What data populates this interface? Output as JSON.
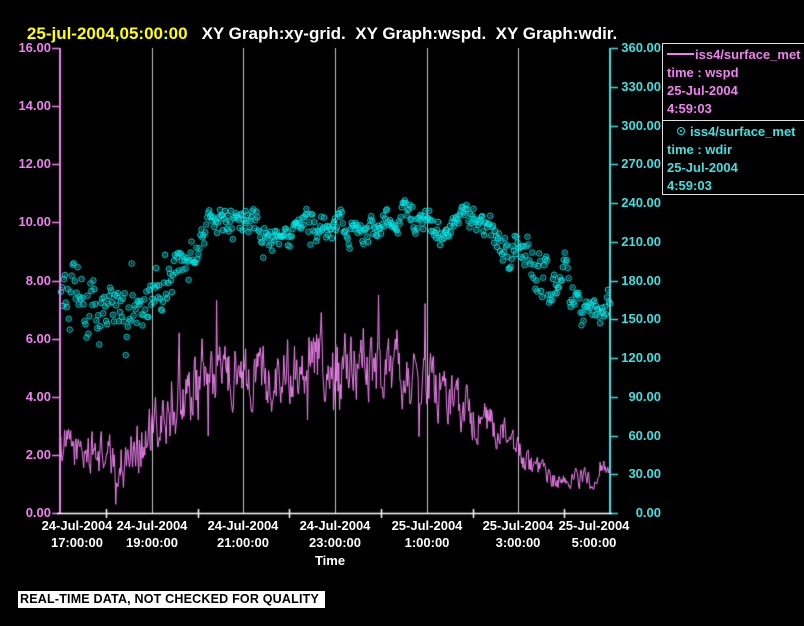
{
  "title": {
    "timestamp": "25-jul-2004,05:00:00",
    "graphs": "XY Graph:xy-grid.  XY Graph:wspd.  XY Graph:wdir."
  },
  "colors": {
    "background": "#000000",
    "title_time": "#ffff00",
    "title_text": "#ffffff",
    "wspd": "#ee82ee",
    "wdir_marker": "#00eeee",
    "wdir_text": "#40e0e0",
    "grid": "#c4c4c4",
    "x_axis": "#ffffff"
  },
  "left_axis": {
    "tick_labels": [
      "16.00",
      "14.00",
      "12.00",
      "10.00",
      "8.00",
      "6.00",
      "4.00",
      "2.00",
      "0.00"
    ]
  },
  "right_axis": {
    "tick_labels": [
      "360.00",
      "330.00",
      "300.00",
      "270.00",
      "240.00",
      "210.00",
      "180.00",
      "150.00",
      "120.00",
      "90.00",
      "60.00",
      "30.00",
      "0.00"
    ]
  },
  "x_axis": {
    "title": "Time",
    "ticks": [
      {
        "date": "24-Jul-2004",
        "time": "17:00:00"
      },
      {
        "date": "24-Jul-2004",
        "time": "19:00:00"
      },
      {
        "date": "24-Jul-2004",
        "time": "21:00:00"
      },
      {
        "date": "24-Jul-2004",
        "time": "23:00:00"
      },
      {
        "date": "25-Jul-2004",
        "time": "1:00:00"
      },
      {
        "date": "25-Jul-2004",
        "time": "3:00:00"
      },
      {
        "date": "25-Jul-2004",
        "time": "5:00:00"
      }
    ]
  },
  "legend": {
    "entries": [
      {
        "symbol": "line",
        "source": "iss4/surface_met",
        "field": "time : wspd",
        "date": "25-Jul-2004",
        "time": "4:59:03",
        "color": "#ee82ee"
      },
      {
        "symbol": "circle",
        "source": "iss4/surface_met",
        "field": "time : wdir",
        "date": "25-Jul-2004",
        "time": "4:59:03",
        "color": "#40e0e0"
      }
    ]
  },
  "banner": "REAL-TIME DATA, NOT CHECKED FOR QUALITY",
  "chart_data": {
    "type": "line+scatter",
    "title": "XY Graph: wspd (line, left axis) and wdir (scatter, right axis) vs Time",
    "xlabel": "Time",
    "x_range_hours": [
      0,
      12
    ],
    "x_start_label": "24-Jul-2004 17:00:00",
    "x_end_label": "25-Jul-2004 05:00:00",
    "left_ylim": [
      0,
      16
    ],
    "right_ylim": [
      0,
      360
    ],
    "grid": "vertical gridlines at 2-hour major ticks",
    "grid_hours": [
      2,
      4,
      6,
      8,
      10
    ],
    "minor_tick_hours": [
      1,
      3,
      5,
      7,
      9,
      11
    ],
    "legend_position": "top-right",
    "series": [
      {
        "name": "wspd",
        "type": "line",
        "axis": "left",
        "color": "#ee82ee",
        "points_per_hour": 60,
        "seed": 1234,
        "mean_keyframes": [
          [
            0,
            2.4
          ],
          [
            0.5,
            2.1
          ],
          [
            1,
            2.0
          ],
          [
            1.3,
            1.5
          ],
          [
            1.6,
            2.3
          ],
          [
            2,
            2.6
          ],
          [
            2.5,
            3.6
          ],
          [
            3,
            4.3
          ],
          [
            3.5,
            4.7
          ],
          [
            4,
            4.9
          ],
          [
            4.5,
            4.6
          ],
          [
            5,
            5.0
          ],
          [
            5.5,
            5.3
          ],
          [
            6,
            5.1
          ],
          [
            6.5,
            5.0
          ],
          [
            7,
            4.9
          ],
          [
            7.5,
            4.7
          ],
          [
            8,
            4.5
          ],
          [
            8.5,
            4.0
          ],
          [
            9,
            3.4
          ],
          [
            9.5,
            2.9
          ],
          [
            10,
            2.1
          ],
          [
            10.4,
            1.4
          ],
          [
            10.8,
            1.1
          ],
          [
            11.2,
            1.2
          ],
          [
            11.6,
            1.2
          ],
          [
            12,
            1.5
          ]
        ],
        "noise_sd_keyframes": [
          [
            0,
            0.6
          ],
          [
            1,
            0.7
          ],
          [
            2,
            0.9
          ],
          [
            3,
            1.0
          ],
          [
            4,
            0.9
          ],
          [
            5,
            1.0
          ],
          [
            6,
            1.0
          ],
          [
            7,
            0.95
          ],
          [
            8,
            0.9
          ],
          [
            9,
            0.7
          ],
          [
            10,
            0.45
          ],
          [
            11,
            0.3
          ],
          [
            12,
            0.35
          ]
        ],
        "anomalies": [
          [
            1.22,
            0.3
          ],
          [
            2.6,
            6.2
          ],
          [
            3.1,
            6.0
          ],
          [
            5.7,
            6.9
          ],
          [
            7.35,
            6.3
          ]
        ]
      },
      {
        "name": "wdir",
        "type": "scatter",
        "axis": "right",
        "color": "#00eeee",
        "n_points": 560,
        "seed": 9271,
        "mean_keyframes": [
          [
            0,
            160
          ],
          [
            0.5,
            168
          ],
          [
            1,
            150
          ],
          [
            1.5,
            148
          ],
          [
            2,
            168
          ],
          [
            2.5,
            188
          ],
          [
            3,
            205
          ],
          [
            3.3,
            228
          ],
          [
            3.7,
            225
          ],
          [
            4,
            224
          ],
          [
            4.5,
            220
          ],
          [
            5,
            213
          ],
          [
            5.3,
            222
          ],
          [
            5.7,
            218
          ],
          [
            6,
            226
          ],
          [
            6.3,
            220
          ],
          [
            6.7,
            215
          ],
          [
            7,
            227
          ],
          [
            7.3,
            232
          ],
          [
            7.7,
            225
          ],
          [
            8,
            228
          ],
          [
            8.3,
            215
          ],
          [
            8.7,
            228
          ],
          [
            9,
            232
          ],
          [
            9.3,
            222
          ],
          [
            9.6,
            210
          ],
          [
            10,
            205
          ],
          [
            10.3,
            190
          ],
          [
            10.7,
            172
          ],
          [
            11,
            178
          ],
          [
            11.3,
            162
          ],
          [
            11.7,
            158
          ],
          [
            12,
            165
          ]
        ],
        "spread_sd_keyframes": [
          [
            0,
            26
          ],
          [
            1,
            30
          ],
          [
            2,
            24
          ],
          [
            3,
            16
          ],
          [
            4,
            13
          ],
          [
            5,
            12
          ],
          [
            6,
            12
          ],
          [
            7,
            10
          ],
          [
            8,
            10
          ],
          [
            9,
            10
          ],
          [
            10,
            18
          ],
          [
            10.5,
            22
          ],
          [
            11,
            18
          ],
          [
            12,
            12
          ]
        ]
      }
    ]
  }
}
